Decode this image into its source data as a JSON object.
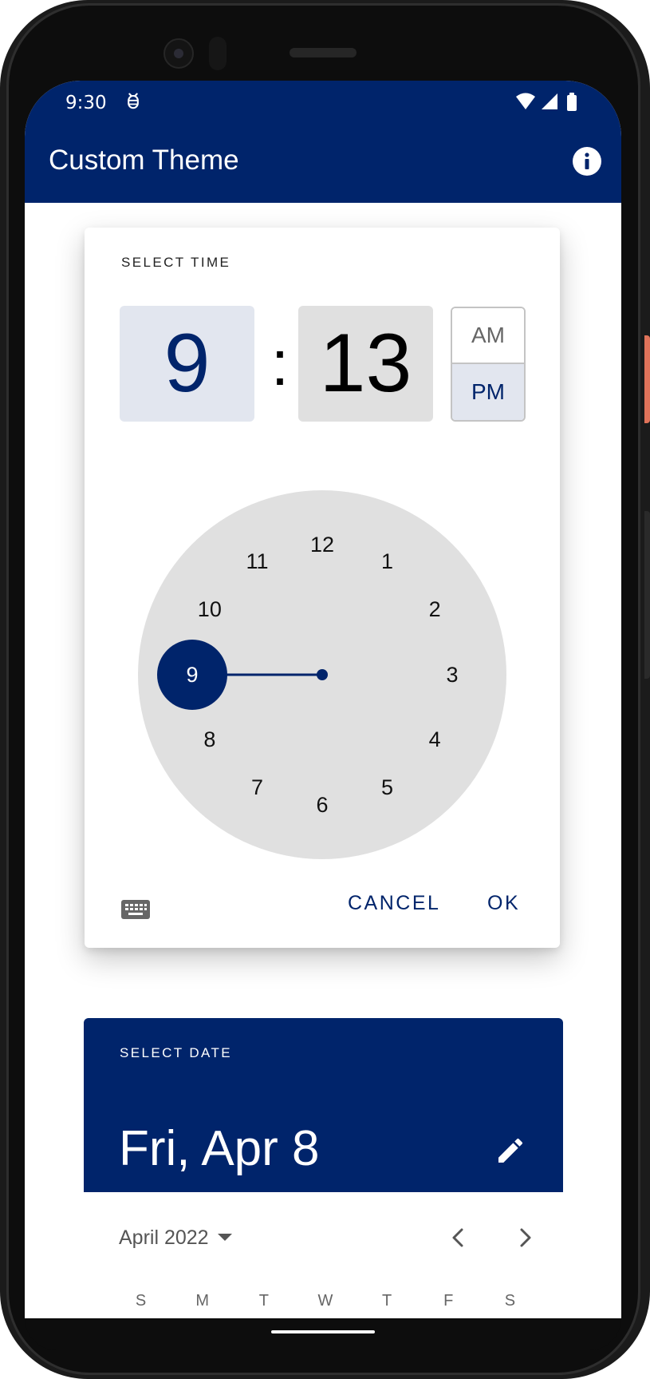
{
  "status_bar": {
    "time": "9:30",
    "icons": [
      "debug-icon",
      "wifi-icon",
      "signal-icon",
      "battery-icon"
    ]
  },
  "app_bar": {
    "title": "Custom Theme",
    "action_icon": "info-icon"
  },
  "time_picker": {
    "title": "SELECT TIME",
    "hour": "9",
    "separator": ":",
    "minute": "13",
    "am_label": "AM",
    "pm_label": "PM",
    "selected_period": "PM",
    "selected_hour": 9,
    "clock_numbers": [
      "12",
      "1",
      "2",
      "3",
      "4",
      "5",
      "6",
      "7",
      "8",
      "9",
      "10",
      "11"
    ],
    "input_mode_icon": "keyboard-icon",
    "cancel_label": "CANCEL",
    "ok_label": "OK"
  },
  "date_picker": {
    "title": "SELECT DATE",
    "selected_date": "Fri, Apr 8",
    "edit_icon": "pencil-icon",
    "month_label": "April 2022",
    "weekdays": [
      "S",
      "M",
      "T",
      "W",
      "T",
      "F",
      "S"
    ]
  },
  "colors": {
    "primary": "#00246b",
    "hour_bg": "#e2e6ef",
    "minute_bg": "#e0e0e0",
    "clock_face": "#e0e0e0"
  }
}
